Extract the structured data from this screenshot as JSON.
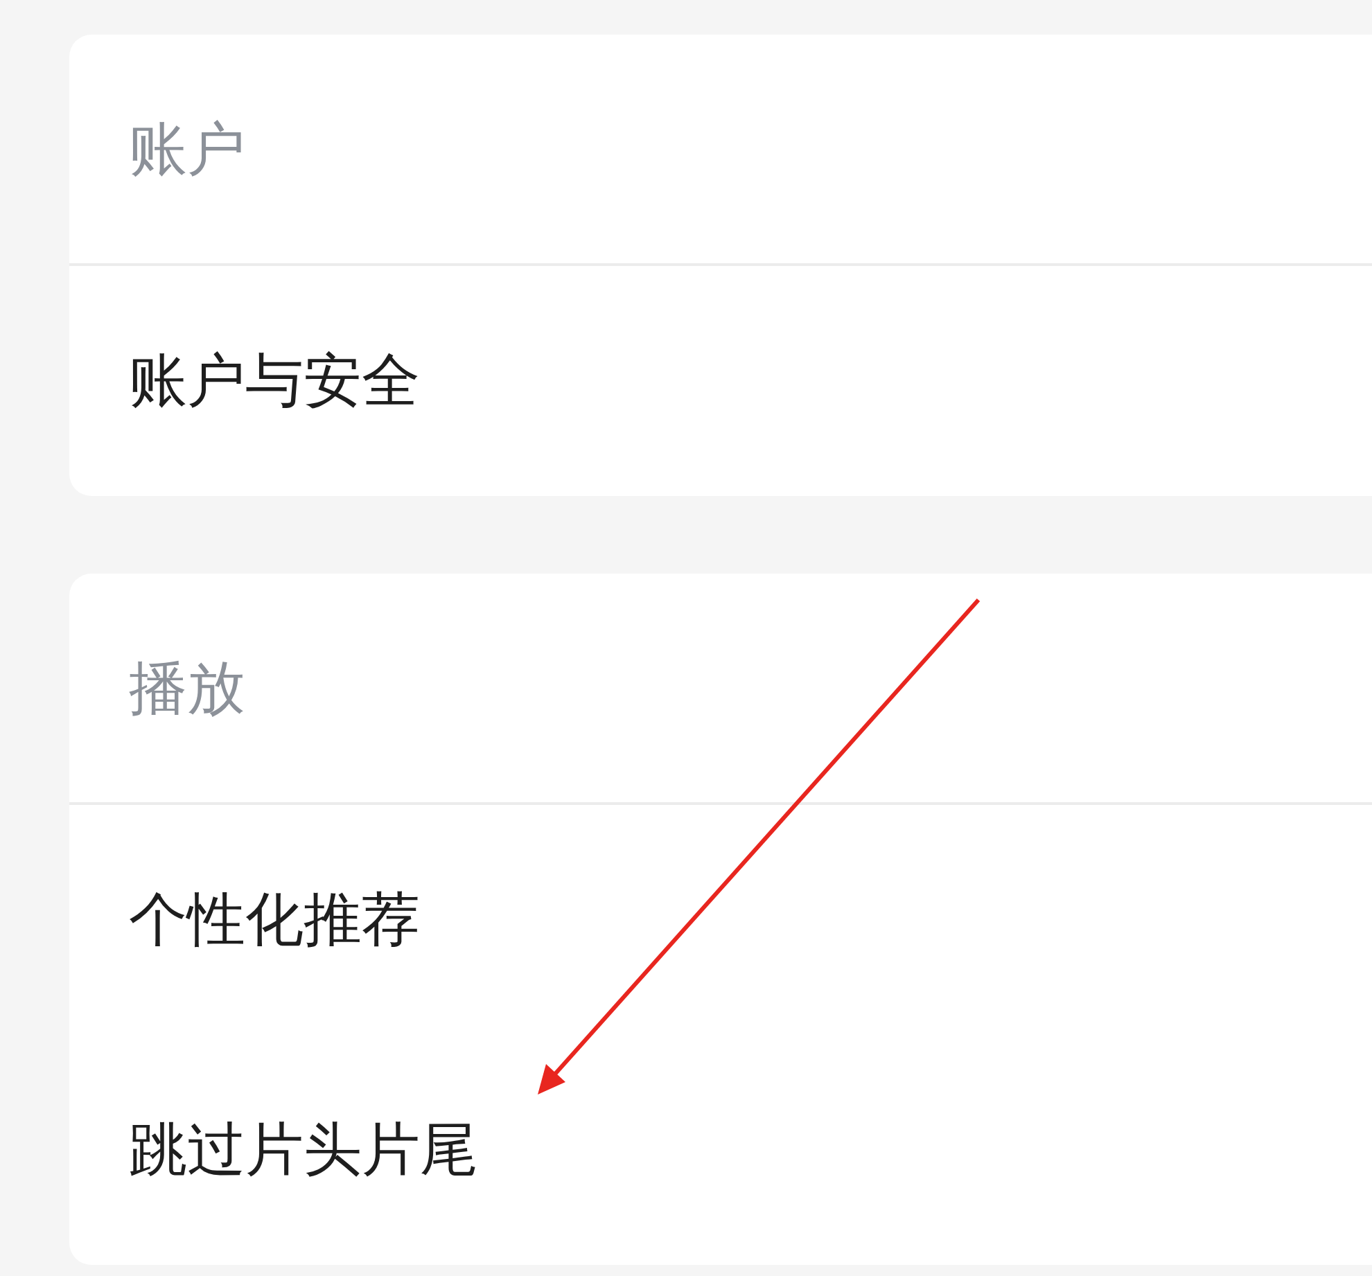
{
  "sections": [
    {
      "header": "账户",
      "items": [
        {
          "label": "账户与安全"
        }
      ]
    },
    {
      "header": "播放",
      "items": [
        {
          "label": "个性化推荐"
        },
        {
          "label": "跳过片头片尾"
        }
      ]
    }
  ]
}
